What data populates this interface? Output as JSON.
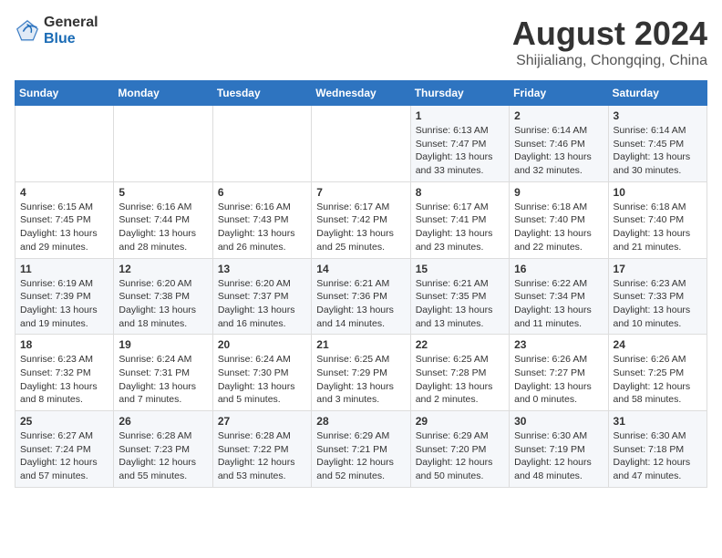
{
  "header": {
    "logo_line1": "General",
    "logo_line2": "Blue",
    "month_year": "August 2024",
    "location": "Shijialiang, Chongqing, China"
  },
  "days_of_week": [
    "Sunday",
    "Monday",
    "Tuesday",
    "Wednesday",
    "Thursday",
    "Friday",
    "Saturday"
  ],
  "weeks": [
    [
      {
        "day": "",
        "info": ""
      },
      {
        "day": "",
        "info": ""
      },
      {
        "day": "",
        "info": ""
      },
      {
        "day": "",
        "info": ""
      },
      {
        "day": "1",
        "info": "Sunrise: 6:13 AM\nSunset: 7:47 PM\nDaylight: 13 hours\nand 33 minutes."
      },
      {
        "day": "2",
        "info": "Sunrise: 6:14 AM\nSunset: 7:46 PM\nDaylight: 13 hours\nand 32 minutes."
      },
      {
        "day": "3",
        "info": "Sunrise: 6:14 AM\nSunset: 7:45 PM\nDaylight: 13 hours\nand 30 minutes."
      }
    ],
    [
      {
        "day": "4",
        "info": "Sunrise: 6:15 AM\nSunset: 7:45 PM\nDaylight: 13 hours\nand 29 minutes."
      },
      {
        "day": "5",
        "info": "Sunrise: 6:16 AM\nSunset: 7:44 PM\nDaylight: 13 hours\nand 28 minutes."
      },
      {
        "day": "6",
        "info": "Sunrise: 6:16 AM\nSunset: 7:43 PM\nDaylight: 13 hours\nand 26 minutes."
      },
      {
        "day": "7",
        "info": "Sunrise: 6:17 AM\nSunset: 7:42 PM\nDaylight: 13 hours\nand 25 minutes."
      },
      {
        "day": "8",
        "info": "Sunrise: 6:17 AM\nSunset: 7:41 PM\nDaylight: 13 hours\nand 23 minutes."
      },
      {
        "day": "9",
        "info": "Sunrise: 6:18 AM\nSunset: 7:40 PM\nDaylight: 13 hours\nand 22 minutes."
      },
      {
        "day": "10",
        "info": "Sunrise: 6:18 AM\nSunset: 7:40 PM\nDaylight: 13 hours\nand 21 minutes."
      }
    ],
    [
      {
        "day": "11",
        "info": "Sunrise: 6:19 AM\nSunset: 7:39 PM\nDaylight: 13 hours\nand 19 minutes."
      },
      {
        "day": "12",
        "info": "Sunrise: 6:20 AM\nSunset: 7:38 PM\nDaylight: 13 hours\nand 18 minutes."
      },
      {
        "day": "13",
        "info": "Sunrise: 6:20 AM\nSunset: 7:37 PM\nDaylight: 13 hours\nand 16 minutes."
      },
      {
        "day": "14",
        "info": "Sunrise: 6:21 AM\nSunset: 7:36 PM\nDaylight: 13 hours\nand 14 minutes."
      },
      {
        "day": "15",
        "info": "Sunrise: 6:21 AM\nSunset: 7:35 PM\nDaylight: 13 hours\nand 13 minutes."
      },
      {
        "day": "16",
        "info": "Sunrise: 6:22 AM\nSunset: 7:34 PM\nDaylight: 13 hours\nand 11 minutes."
      },
      {
        "day": "17",
        "info": "Sunrise: 6:23 AM\nSunset: 7:33 PM\nDaylight: 13 hours\nand 10 minutes."
      }
    ],
    [
      {
        "day": "18",
        "info": "Sunrise: 6:23 AM\nSunset: 7:32 PM\nDaylight: 13 hours\nand 8 minutes."
      },
      {
        "day": "19",
        "info": "Sunrise: 6:24 AM\nSunset: 7:31 PM\nDaylight: 13 hours\nand 7 minutes."
      },
      {
        "day": "20",
        "info": "Sunrise: 6:24 AM\nSunset: 7:30 PM\nDaylight: 13 hours\nand 5 minutes."
      },
      {
        "day": "21",
        "info": "Sunrise: 6:25 AM\nSunset: 7:29 PM\nDaylight: 13 hours\nand 3 minutes."
      },
      {
        "day": "22",
        "info": "Sunrise: 6:25 AM\nSunset: 7:28 PM\nDaylight: 13 hours\nand 2 minutes."
      },
      {
        "day": "23",
        "info": "Sunrise: 6:26 AM\nSunset: 7:27 PM\nDaylight: 13 hours\nand 0 minutes."
      },
      {
        "day": "24",
        "info": "Sunrise: 6:26 AM\nSunset: 7:25 PM\nDaylight: 12 hours\nand 58 minutes."
      }
    ],
    [
      {
        "day": "25",
        "info": "Sunrise: 6:27 AM\nSunset: 7:24 PM\nDaylight: 12 hours\nand 57 minutes."
      },
      {
        "day": "26",
        "info": "Sunrise: 6:28 AM\nSunset: 7:23 PM\nDaylight: 12 hours\nand 55 minutes."
      },
      {
        "day": "27",
        "info": "Sunrise: 6:28 AM\nSunset: 7:22 PM\nDaylight: 12 hours\nand 53 minutes."
      },
      {
        "day": "28",
        "info": "Sunrise: 6:29 AM\nSunset: 7:21 PM\nDaylight: 12 hours\nand 52 minutes."
      },
      {
        "day": "29",
        "info": "Sunrise: 6:29 AM\nSunset: 7:20 PM\nDaylight: 12 hours\nand 50 minutes."
      },
      {
        "day": "30",
        "info": "Sunrise: 6:30 AM\nSunset: 7:19 PM\nDaylight: 12 hours\nand 48 minutes."
      },
      {
        "day": "31",
        "info": "Sunrise: 6:30 AM\nSunset: 7:18 PM\nDaylight: 12 hours\nand 47 minutes."
      }
    ]
  ]
}
